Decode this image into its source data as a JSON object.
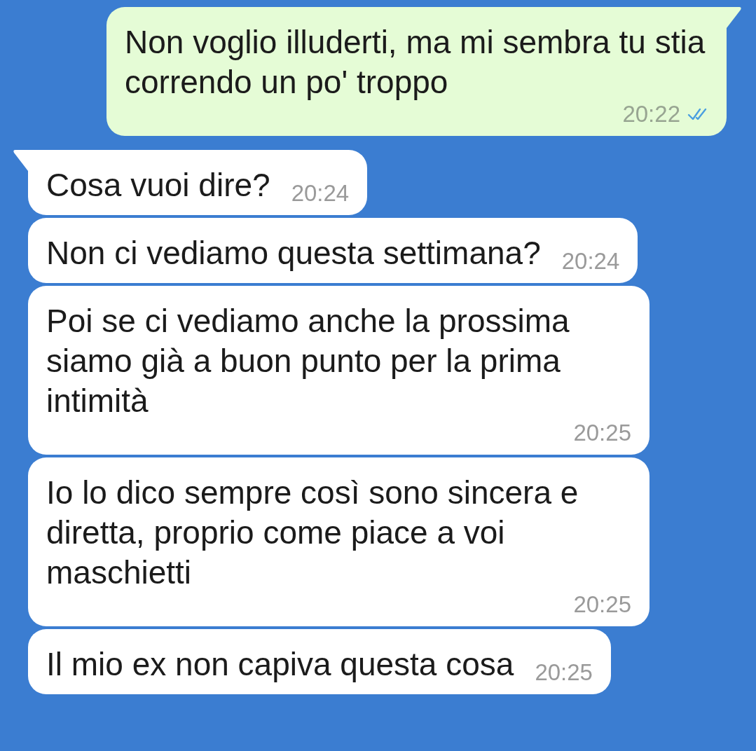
{
  "messages": [
    {
      "kind": "outgoing",
      "tail": true,
      "text": "Non voglio illuderti, ma mi sembra tu stia correndo un po' troppo",
      "time": "20:22",
      "read": true
    },
    {
      "kind": "incoming",
      "tail": true,
      "text": "Cosa vuoi dire?",
      "time": "20:24"
    },
    {
      "kind": "incoming",
      "tail": false,
      "text": "Non ci vediamo questa settimana?",
      "time": "20:24"
    },
    {
      "kind": "incoming",
      "tail": false,
      "text": "Poi se ci vediamo anche la prossima siamo già a buon punto per la prima intimità",
      "time": "20:25"
    },
    {
      "kind": "incoming",
      "tail": false,
      "text": "Io lo dico sempre così sono sincera e diretta, proprio come piace a voi maschietti",
      "time": "20:25"
    },
    {
      "kind": "incoming",
      "tail": false,
      "text": "Il mio ex non capiva questa cosa",
      "time": "20:25"
    }
  ]
}
